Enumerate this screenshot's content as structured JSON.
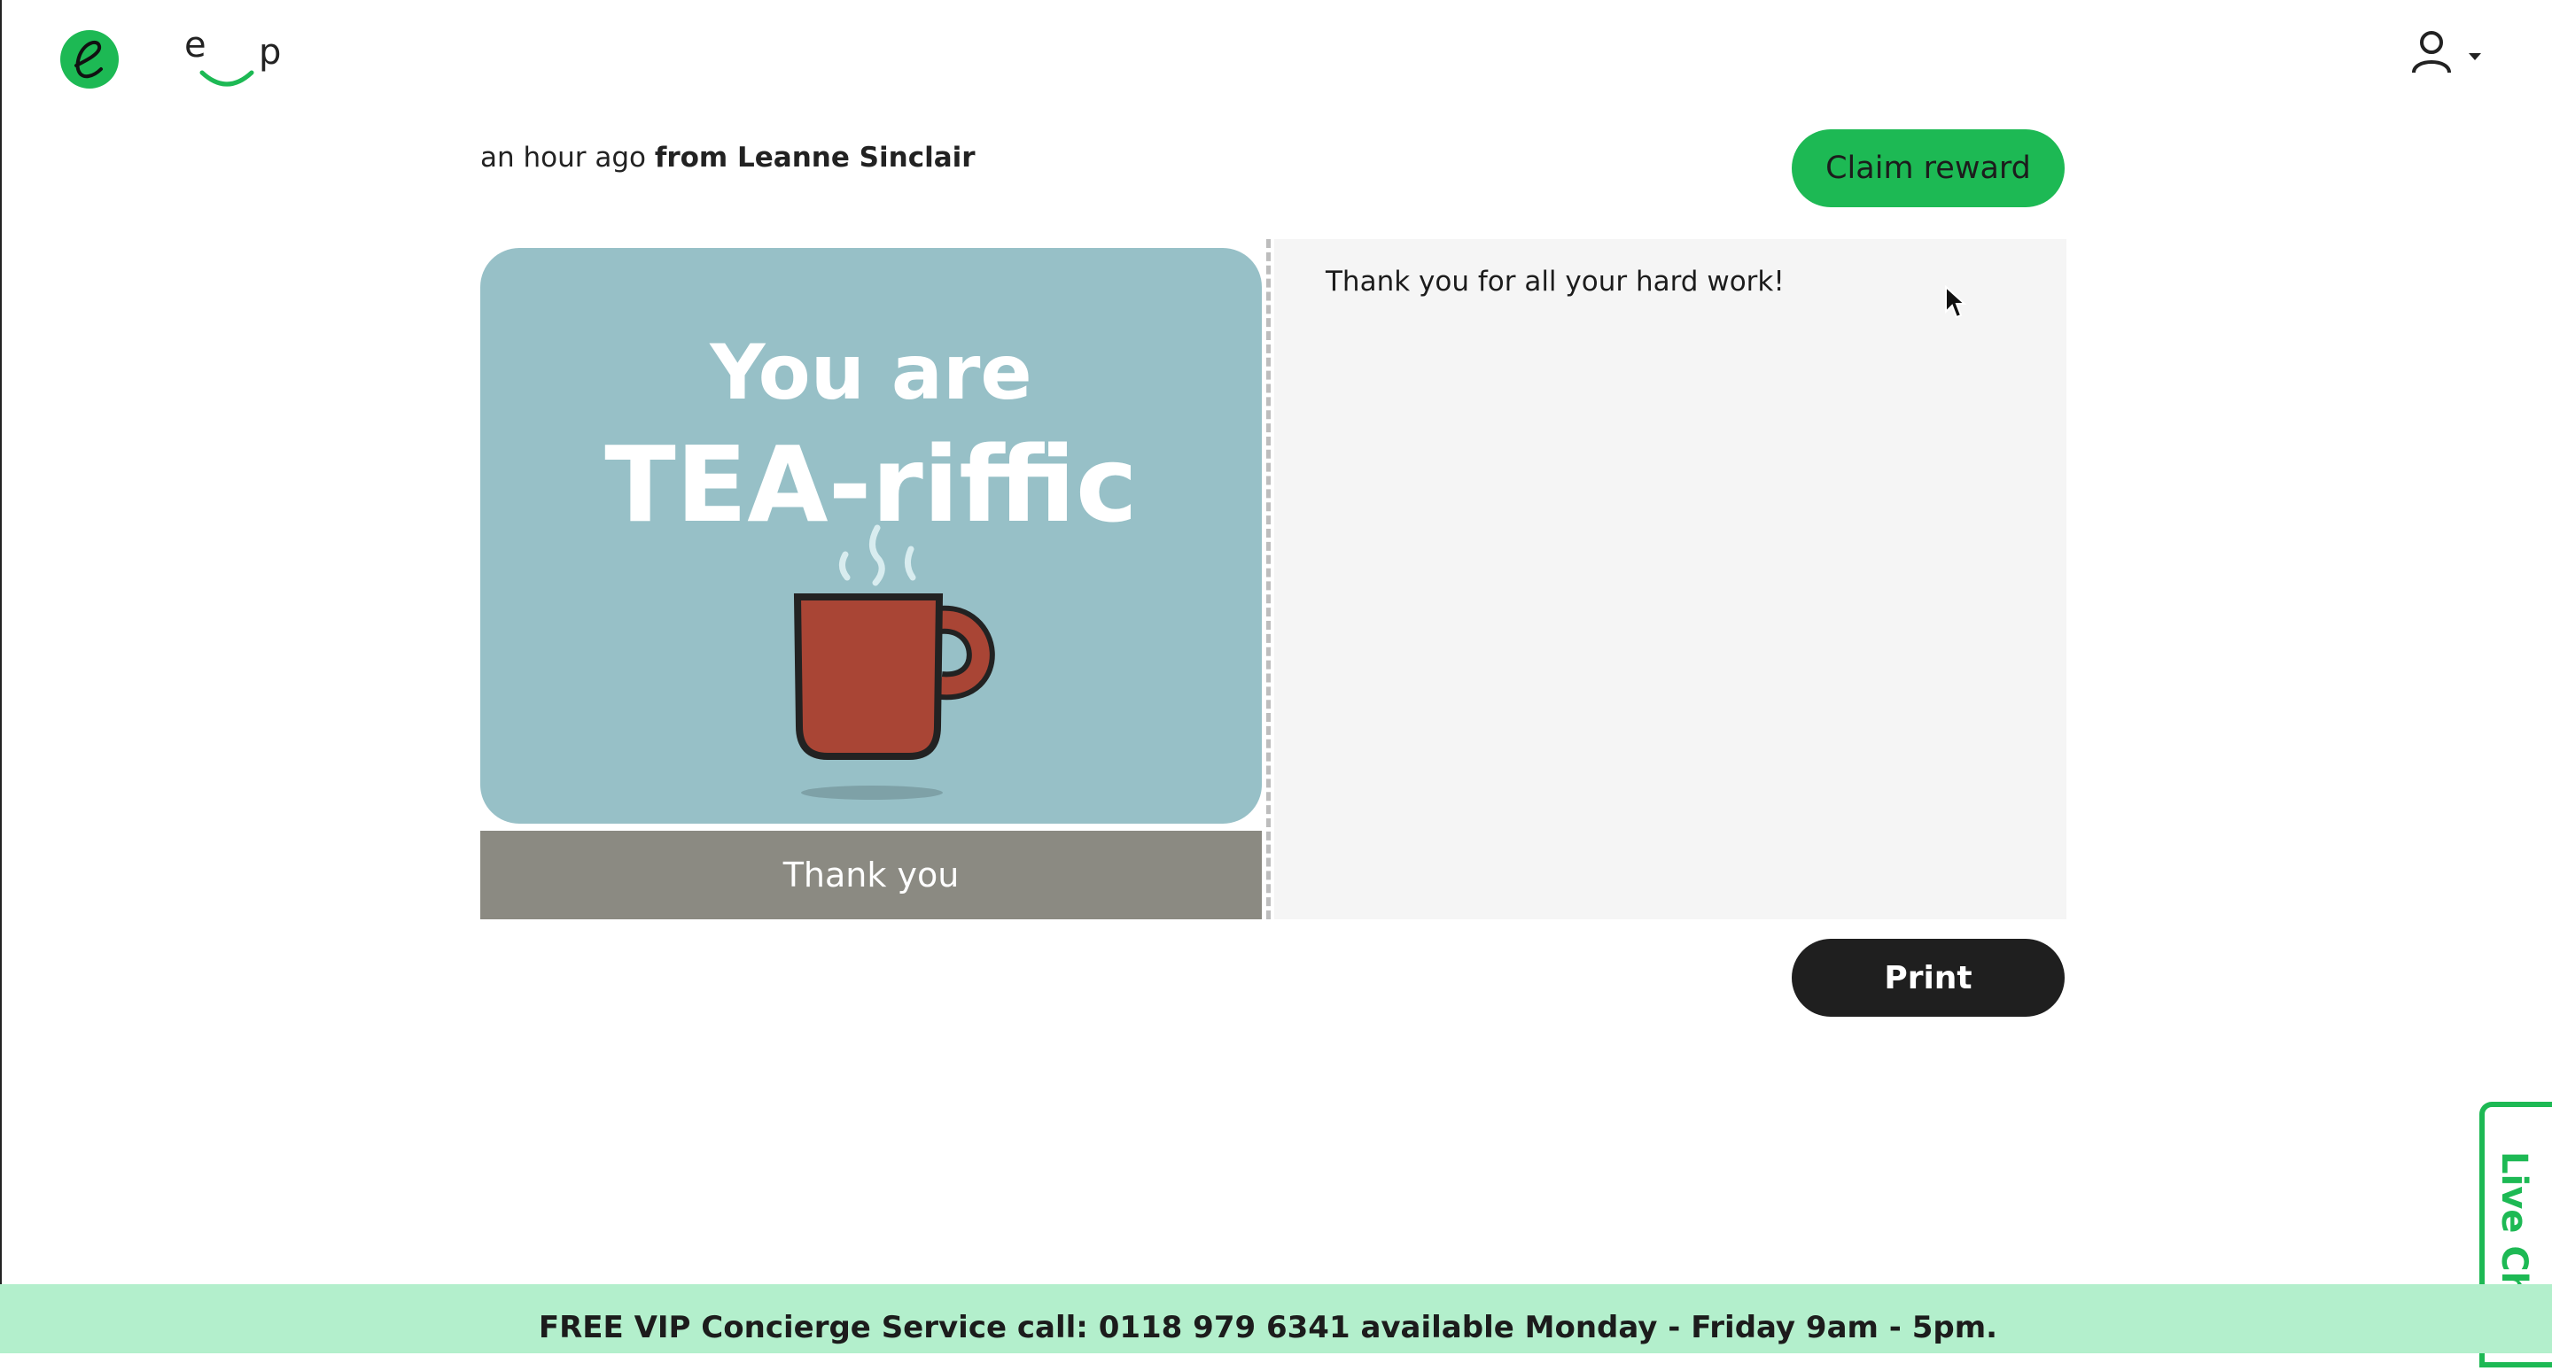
{
  "header": {
    "brand_letters": [
      "e",
      "p"
    ],
    "account_icon": "user-icon",
    "account_caret": "caret-down-icon"
  },
  "recognition": {
    "time_ago": "an hour ago",
    "from_label": "from Leanne Sinclair",
    "claim_button": "Claim reward",
    "card_line1": "You are",
    "card_line2": "TEA-riffic",
    "card_caption": "Thank you",
    "message": "Thank you for all your hard work!",
    "print_button": "Print"
  },
  "live_chat": {
    "label": "Live Chat"
  },
  "footer": {
    "text": "FREE VIP Concierge Service call: 0118 979 6341 available Monday - Friday 9am - 5pm."
  },
  "colors": {
    "brand_green": "#1db954",
    "card_blue": "#97c0c7",
    "caption_grey": "#8b8a82",
    "footer_mint": "#b3efcc",
    "mug_red": "#a94535"
  }
}
